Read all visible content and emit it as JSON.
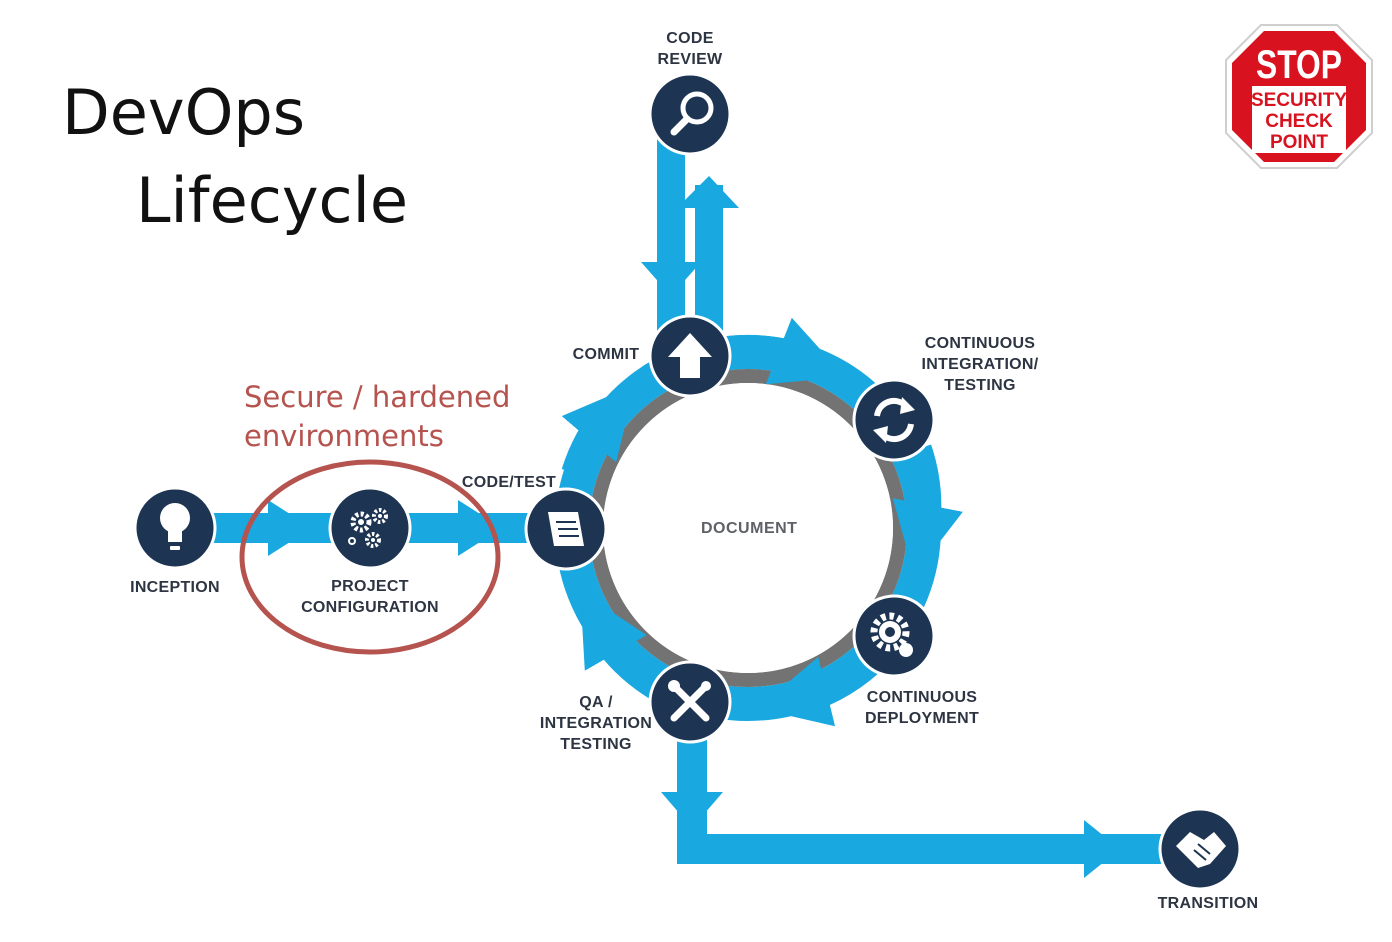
{
  "title": {
    "line1": "DevOps",
    "line2": "Lifecycle"
  },
  "annotation": {
    "line1": "Secure / hardened",
    "line2": "environments"
  },
  "stop_sign": {
    "stop": "STOP",
    "line1": "SECURITY",
    "line2": "CHECK",
    "line3": "POINT"
  },
  "center": "DOCUMENT",
  "nodes": {
    "inception": {
      "line1": "INCEPTION"
    },
    "project_configuration": {
      "line1": "PROJECT",
      "line2": "CONFIGURATION"
    },
    "code_test": {
      "line1": "CODE/TEST"
    },
    "commit": {
      "line1": "COMMIT"
    },
    "code_review": {
      "line1": "CODE",
      "line2": "REVIEW"
    },
    "continuous_integration": {
      "line1": "CONTINUOUS",
      "line2": "INTEGRATION/",
      "line3": "TESTING"
    },
    "continuous_deployment": {
      "line1": "CONTINUOUS",
      "line2": "DEPLOYMENT"
    },
    "qa_integration": {
      "line1": "QA /",
      "line2": "INTEGRATION",
      "line3": "TESTING"
    },
    "transition": {
      "line1": "TRANSITION"
    }
  },
  "colors": {
    "flow": "#19a8df",
    "node": "#1d3553",
    "ring": "#737373",
    "highlight": "#b5534f",
    "stop": "#d8131f"
  }
}
